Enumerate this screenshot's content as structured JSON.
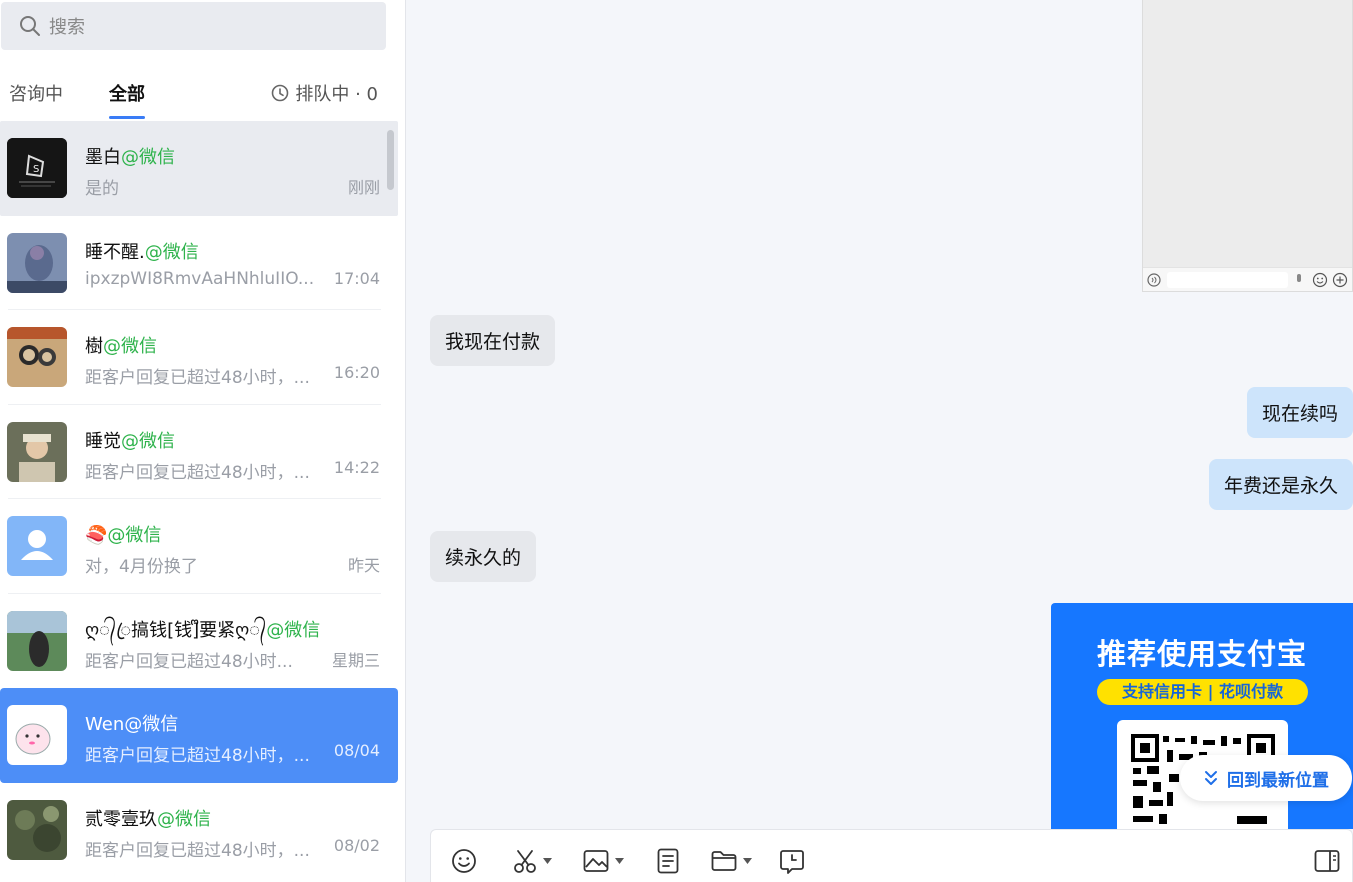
{
  "sidebar": {
    "search_placeholder": "搜索",
    "tabs": [
      {
        "label": "咨询中"
      },
      {
        "label": "全部"
      }
    ],
    "queue_label": "排队中 · 0",
    "conversations": [
      {
        "name": "墨白",
        "source": "@微信",
        "preview": "是的",
        "time": "刚刚"
      },
      {
        "name": "睡不醒.",
        "source": "@微信",
        "preview": "ipxzpWI8RmvAaHNhluIIO...",
        "time": "17:04"
      },
      {
        "name": "樹",
        "source": "@微信",
        "preview": "距客户回复已超过48小时，...",
        "time": "16:20"
      },
      {
        "name": "睡觉",
        "source": "@微信",
        "preview": "距客户回复已超过48小时，...",
        "time": "14:22"
      },
      {
        "name": "🍣",
        "source": "@微信",
        "preview": "对，4月份换了",
        "time": "昨天"
      },
      {
        "name": "ღ᭄ꦿ搞钱[钱]ᩚ要紧ღ᭄",
        "source": "@微信",
        "preview": "距客户回复已超过48小时...",
        "time": "星期三"
      },
      {
        "name": "Wen",
        "source": "@微信",
        "preview": "距客户回复已超过48小时，...",
        "time": "08/04"
      },
      {
        "name": "贰零壹玖",
        "source": "@微信",
        "preview": "距客户回复已超过48小时，...",
        "time": "08/02"
      }
    ]
  },
  "chat": {
    "messages": [
      {
        "side": "left",
        "text": "我现在付款"
      },
      {
        "side": "right",
        "text": "现在续吗"
      },
      {
        "side": "right",
        "text": "年费还是永久"
      },
      {
        "side": "left",
        "text": "续永久的"
      }
    ],
    "ad": {
      "title": "推荐使用支付宝",
      "subtitle": "支持信用卡 | 花呗付款"
    },
    "back_to_latest": "回到最新位置"
  },
  "toolbar": {
    "icons": [
      "emoji-icon",
      "scissors-icon",
      "image-icon",
      "document-icon",
      "folder-icon",
      "history-icon",
      "sidebar-toggle-icon"
    ]
  },
  "colors": {
    "accent": "#4d8ef7",
    "source_green": "#2fb34c",
    "bubble_right": "#cde4fb",
    "bubble_left": "#e6e8ec"
  }
}
